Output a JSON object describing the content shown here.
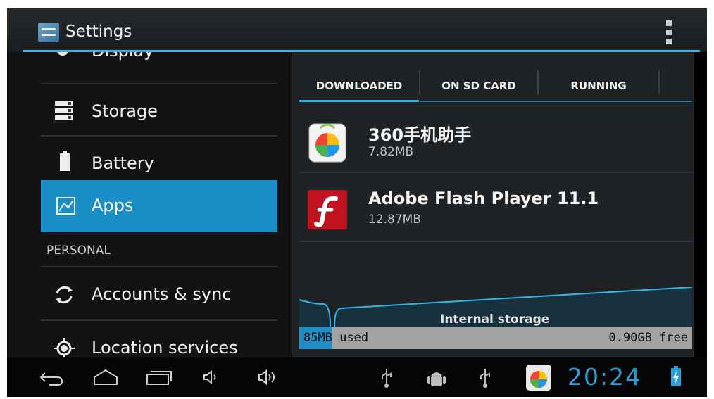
{
  "action_bar": {
    "title": "Settings"
  },
  "settings_list": {
    "partial_item": "Display",
    "items": [
      {
        "label": "Storage"
      },
      {
        "label": "Battery"
      },
      {
        "label": "Apps",
        "selected": true
      }
    ],
    "section_header": "PERSONAL",
    "personal_items": [
      {
        "label": "Accounts & sync"
      },
      {
        "label": "Location services"
      }
    ]
  },
  "apps": {
    "tabs": [
      {
        "label": "DOWNLOADED",
        "selected": true
      },
      {
        "label": "ON SD CARD"
      },
      {
        "label": "RUNNING"
      }
    ],
    "list": [
      {
        "name": "360手机助手",
        "size": "7.82MB",
        "icon": "360-assistant-icon"
      },
      {
        "name": "Adobe Flash Player 11.1",
        "size": "12.87MB",
        "icon": "flash-player-icon"
      }
    ],
    "storage": {
      "label": "Internal storage",
      "used": "85MB used",
      "free": "0.90GB free",
      "used_fraction": 0.085
    }
  },
  "status_bar": {
    "time": "20:24",
    "icons": [
      "usb-icon",
      "android-debug-icon",
      "usb-icon",
      "360-notification-icon",
      "battery-charging-icon"
    ]
  },
  "colors": {
    "accent": "#33b5e5",
    "selected": "#1a8ec6",
    "clock": "#2a9ed6"
  }
}
